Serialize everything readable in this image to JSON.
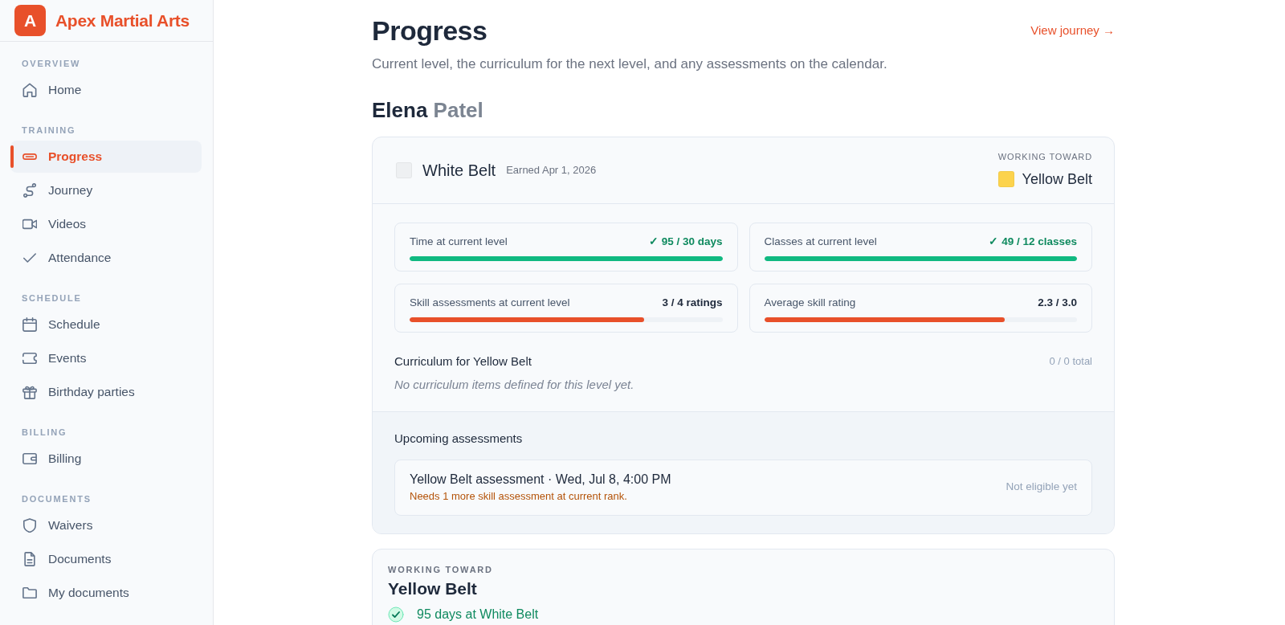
{
  "brand": {
    "logo_letter": "A",
    "name": "Apex Martial Arts"
  },
  "sidebar": {
    "sections": [
      {
        "label": "OVERVIEW",
        "items": [
          {
            "label": "Home",
            "selected": false
          }
        ]
      },
      {
        "label": "TRAINING",
        "items": [
          {
            "label": "Progress",
            "selected": true
          },
          {
            "label": "Journey",
            "selected": false
          },
          {
            "label": "Videos",
            "selected": false
          },
          {
            "label": "Attendance",
            "selected": false
          }
        ]
      },
      {
        "label": "SCHEDULE",
        "items": [
          {
            "label": "Schedule",
            "selected": false
          },
          {
            "label": "Events",
            "selected": false
          },
          {
            "label": "Birthday parties",
            "selected": false
          }
        ]
      },
      {
        "label": "BILLING",
        "items": [
          {
            "label": "Billing",
            "selected": false
          }
        ]
      },
      {
        "label": "DOCUMENTS",
        "items": [
          {
            "label": "Waivers",
            "selected": false
          },
          {
            "label": "Documents",
            "selected": false
          },
          {
            "label": "My documents",
            "selected": false
          }
        ]
      }
    ]
  },
  "header": {
    "title": "Progress",
    "link": "View journey →",
    "subtitle": "Current level, the curriculum for the next level, and any assessments on the calendar."
  },
  "student": {
    "first_name": "Elena",
    "last_name": "Patel"
  },
  "rank_card": {
    "current_belt": {
      "name": "White Belt",
      "color": "#eef0f2",
      "earned": "Earned Apr 1, 2026"
    },
    "next_belt": {
      "caption": "WORKING TOWARD",
      "name": "Yellow Belt",
      "color": "#fcd34d"
    },
    "requirements": [
      {
        "label": "Time at current level",
        "reading": "✓ 95 / 30 days",
        "met": true,
        "level": 1
      },
      {
        "label": "Classes at current level",
        "reading": "✓ 49 / 12 classes",
        "met": true,
        "level": 1
      },
      {
        "label": "Skill assessments at current level",
        "reading": "3 / 4 ratings",
        "met": false,
        "level": 0.75
      },
      {
        "label": "Average skill rating",
        "reading": "2.3 / 3.0",
        "met": false,
        "level": 0.77
      }
    ],
    "curriculum": {
      "title": "Curriculum for Yellow Belt",
      "count": "0 / 0 total",
      "empty_note": "No curriculum items defined for this level yet."
    },
    "upcoming": {
      "title": "Upcoming assessments",
      "items": [
        {
          "title": "Yellow Belt assessment · Wed, Jul 8, 4:00 PM",
          "note": "Needs 1 more skill assessment at current rank.",
          "status": "Not eligible yet",
          "eligible": false
        }
      ]
    }
  },
  "goal_card": {
    "caption": "WORKING TOWARD",
    "title": "Yellow Belt",
    "checklist": [
      {
        "label": "95 days at White Belt",
        "met": true
      }
    ]
  }
}
